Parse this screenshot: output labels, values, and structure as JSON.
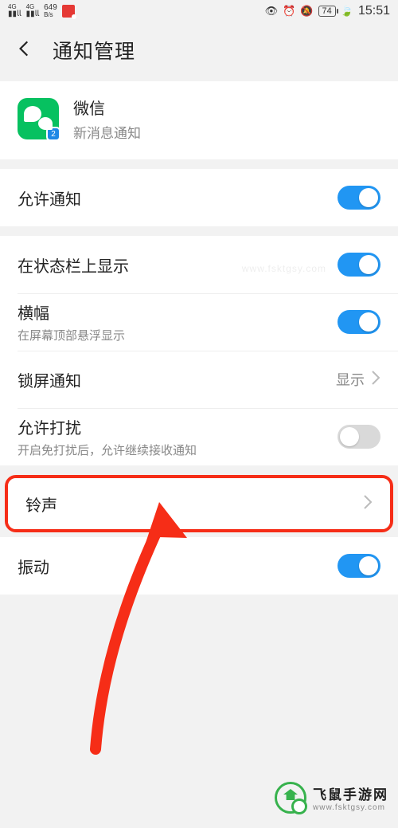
{
  "status_bar": {
    "signal1": "4G",
    "signal2": "4G",
    "speed_val": "649",
    "speed_unit": "B/s",
    "battery": "74",
    "time": "15:51"
  },
  "header": {
    "title": "通知管理"
  },
  "app": {
    "name": "微信",
    "subtitle": "新消息通知",
    "badge": "2"
  },
  "rows": {
    "allow_notify": {
      "title": "允许通知",
      "on": true
    },
    "status_bar_show": {
      "title": "在状态栏上显示",
      "on": true
    },
    "banner": {
      "title": "横幅",
      "sub": "在屏幕顶部悬浮显示",
      "on": true
    },
    "lock_notify": {
      "title": "锁屏通知",
      "value": "显示"
    },
    "allow_disturb": {
      "title": "允许打扰",
      "sub": "开启免打扰后，允许继续接收通知",
      "on": false
    },
    "ringtone": {
      "title": "铃声"
    },
    "vibrate": {
      "title": "振动",
      "on": true
    }
  },
  "watermark": {
    "line1": "飞鼠手游网",
    "line2": "www.fsktgsy.com"
  },
  "url_wm": "www.fsktgsy.com"
}
